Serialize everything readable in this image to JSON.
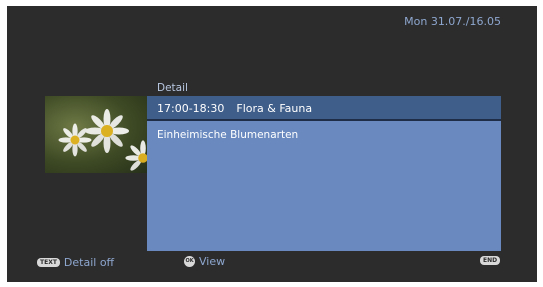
{
  "header": {
    "datetime": "Mon 31.07./16.05"
  },
  "detail": {
    "section_label": "Detail",
    "time": "17:00-18:30",
    "title": "Flora & Fauna",
    "description": "Einheimische Blumenarten",
    "thumbnail_icon": "daisy-flowers-image"
  },
  "footer": {
    "text_button": {
      "badge": "TEXT",
      "label": "Detail off"
    },
    "ok_button": {
      "badge": "OK",
      "label": "View"
    },
    "end_button": {
      "badge": "END"
    }
  },
  "colors": {
    "background": "#2c2c2c",
    "panel": "#6a8abf",
    "panel_header": "#3f5e8a",
    "accent_text": "#8ea7cf"
  }
}
